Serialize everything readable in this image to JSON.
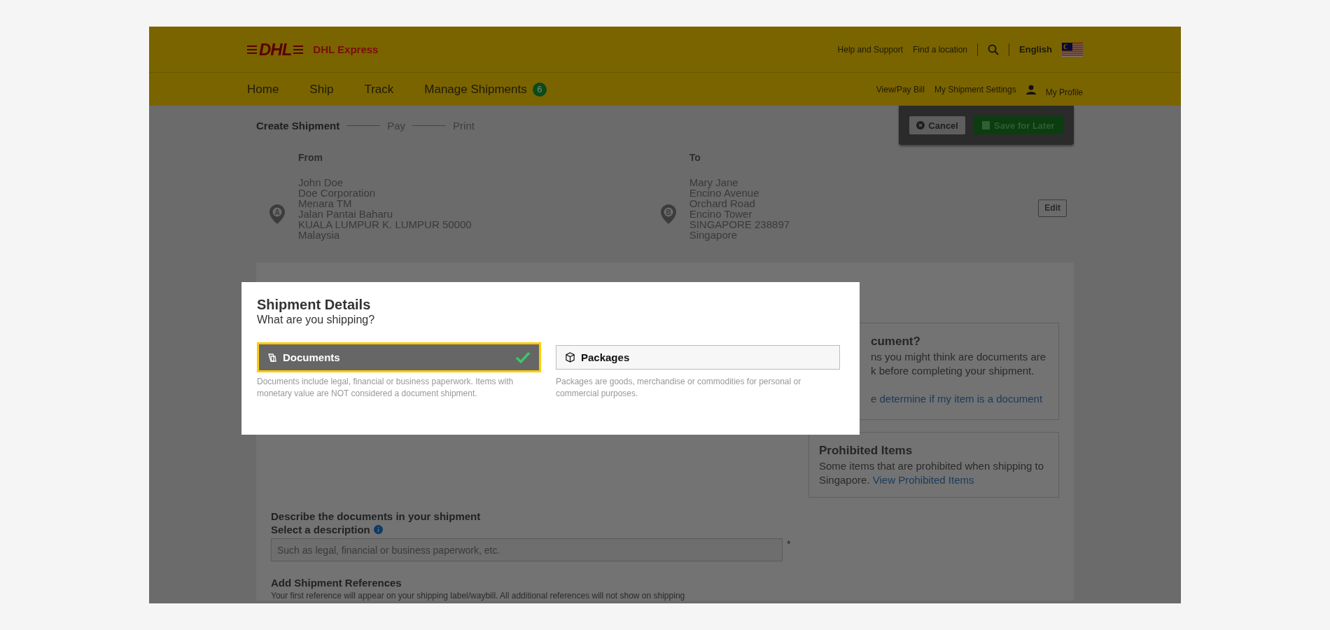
{
  "header": {
    "logo": "DHL",
    "brand": "DHL Express",
    "links": [
      "Help and Support",
      "Find a location"
    ],
    "language": "English"
  },
  "nav": {
    "items": [
      {
        "label": "Home"
      },
      {
        "label": "Ship"
      },
      {
        "label": "Track"
      },
      {
        "label": "Manage Shipments",
        "badge": "6"
      }
    ],
    "links": [
      "View/Pay Bill",
      "My Shipment Settings"
    ],
    "profile": "My Profile"
  },
  "steps": [
    {
      "label": "Create Shipment",
      "selected": true
    },
    {
      "label": "Pay",
      "selected": false
    },
    {
      "label": "Print",
      "selected": false
    }
  ],
  "actions": {
    "cancel": "Cancel",
    "save": "Save for Later"
  },
  "addresses": [
    {
      "heading": "From",
      "pin": "A",
      "lines": [
        "John Doe",
        "Doe Corporation",
        "Menara TM",
        "Jalan Pantai Baharu",
        "KUALA LUMPUR K. LUMPUR 50000",
        "Malaysia"
      ]
    },
    {
      "heading": "To",
      "pin": "B",
      "lines": [
        "Mary Jane",
        "Encino Avenue",
        "Orchard Road",
        "Encino Tower",
        "SINGAPORE 238897",
        "Singapore"
      ]
    }
  ],
  "edit": "Edit",
  "info_boxes": [
    {
      "title": "cument?",
      "lines": [
        "ns you might think are documents are",
        "k before completing your shipment."
      ],
      "link": "e determine if my item is a document"
    },
    {
      "title": "Prohibited Items",
      "lines": [
        "Some items that are prohibited when shipping to"
      ],
      "tail": "Singapore.",
      "link": "View Prohibited Items"
    }
  ],
  "describe": {
    "title": "Describe the documents in your shipment",
    "label": "Select a description",
    "placeholder": "Such as legal, financial or business paperwork, etc.",
    "required": "*"
  },
  "references": {
    "title": "Add Shipment References",
    "text": "Your first reference will appear on your shipping label/waybill. All additional references will not show on shipping"
  },
  "modal": {
    "title": "Shipment Details",
    "subtitle": "What are you shipping?",
    "options": [
      {
        "kind": "documents",
        "label": "Documents",
        "selected": true,
        "description": "Documents include legal, financial or business paperwork. Items with monetary value are NOT considered a document shipment."
      },
      {
        "kind": "packages",
        "label": "Packages",
        "selected": false,
        "description": "Packages are goods, merchandise or commodities for personal or commercial purposes."
      }
    ]
  }
}
